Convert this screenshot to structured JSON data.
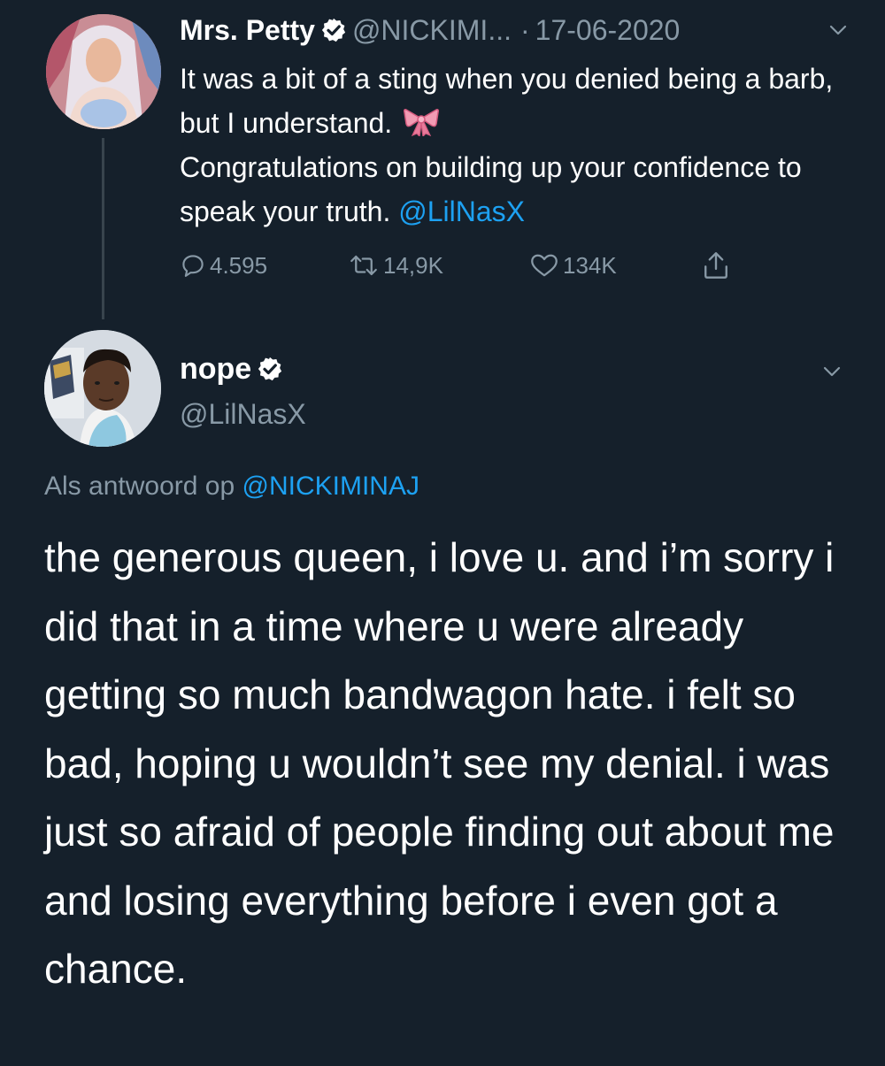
{
  "original_tweet": {
    "display_name": "Mrs. Petty",
    "handle": "@NICKIMI...",
    "separator": "·",
    "date": "17-06-2020",
    "text_before_mention": "It was a bit of a sting when you denied being a barb, but I understand.",
    "text_after_bow": "Congratulations on building up your confidence to speak your truth.",
    "mention": "@LilNasX",
    "actions": {
      "replies": "4.595",
      "retweets": "14,9K",
      "likes": "134K"
    },
    "icons": [
      "verified-badge-icon",
      "chevron-down-icon",
      "ribbon-bow-emoji",
      "reply-icon",
      "retweet-icon",
      "like-icon",
      "share-icon"
    ]
  },
  "reply_tweet": {
    "display_name": "nope",
    "handle": "@LilNasX",
    "reply_prefix": "Als antwoord op",
    "reply_mention": "@NICKIMINAJ",
    "text": "the generous queen, i love u. and i’m sorry i did that in a time where u were already getting so much bandwagon hate. i felt so bad, hoping u wouldn’t see my denial. i was just so afraid of people finding out about me and losing everything before i even got a chance.",
    "icons": [
      "verified-badge-icon",
      "chevron-down-icon"
    ]
  },
  "colors": {
    "background": "#15202b",
    "text_primary": "#ffffff",
    "text_secondary": "#8899a6",
    "accent": "#1da1f2",
    "thread_line": "#38444d"
  }
}
